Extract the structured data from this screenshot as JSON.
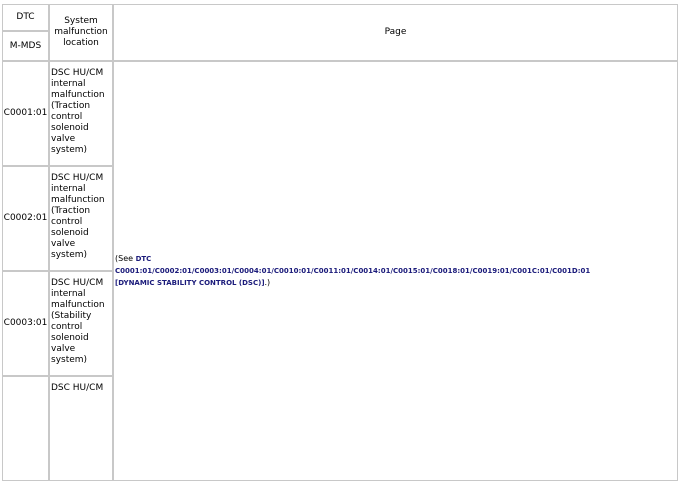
{
  "header": {
    "dtc": "DTC",
    "mmds": "M-MDS",
    "location": "System malfunction location",
    "location_lines": [
      "System",
      "malfunction",
      "location"
    ],
    "page": "Page"
  },
  "rows": [
    {
      "code": "C0001:01",
      "location_lines": [
        "DSC HU/CM",
        "internal",
        "malfunction",
        "(Traction",
        "control",
        "solenoid",
        "valve",
        "system)"
      ]
    },
    {
      "code": "C0002:01",
      "location_lines": [
        "DSC HU/CM",
        "internal",
        "malfunction",
        "(Traction",
        "control",
        "solenoid",
        "valve",
        "system)"
      ]
    },
    {
      "code": "C0003:01",
      "location_lines": [
        "DSC HU/CM",
        "internal",
        "malfunction",
        "(Stability",
        "control",
        "solenoid",
        "valve",
        "system)"
      ]
    },
    {
      "code": "",
      "location_lines": [
        "DSC HU/CM"
      ]
    }
  ],
  "page_ref": {
    "prefix": "(See ",
    "link_line1": "DTC",
    "link_line2": "C0001:01/C0002:01/C0003:01/C0004:01/C0010:01/C0011:01/C0014:01/C0015:01/C0018:01/C0019:01/C001C:01/C001D:01",
    "link_line3": "[DYNAMIC STABILITY CONTROL (DSC)]",
    "suffix": ".)"
  },
  "colors": {
    "border": "#c8c8c8",
    "link": "#1a1a7a"
  }
}
